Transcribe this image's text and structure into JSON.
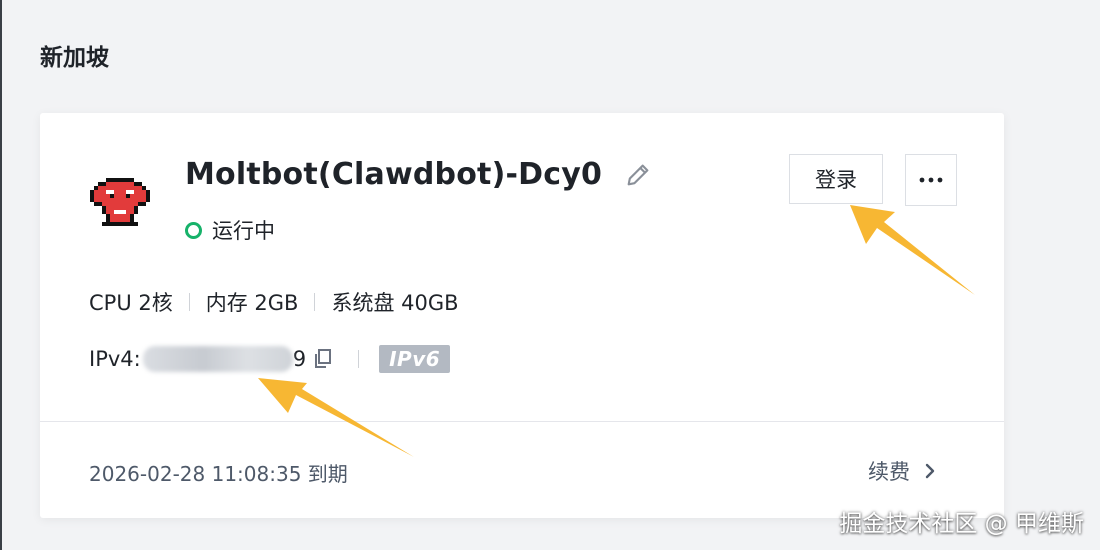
{
  "region": {
    "title": "新加坡"
  },
  "server": {
    "name": "Moltbot(Clawdbot)-Dcy0",
    "status": "运行中",
    "status_color": "#17b26a",
    "avatar_icon": "red-pixel-robot-icon",
    "specs": [
      "CPU 2核",
      "内存 2GB",
      "系统盘 40GB"
    ],
    "ipv4_label": "IPv4:",
    "ipv4_tail": "9",
    "ipv6_badge": "IPv6",
    "expire_text": "2026-02-28 11:08:35 到期"
  },
  "actions": {
    "login_label": "登录",
    "more_icon": "more-horizontal-icon",
    "edit_icon": "pencil-edit-icon",
    "copy_icon": "copy-icon",
    "renew_label": "续费",
    "renew_icon": "chevron-right-icon"
  },
  "annotations": {
    "arrow_color": "#f7b733"
  },
  "watermark": "掘金技术社区 @ 甲维斯"
}
